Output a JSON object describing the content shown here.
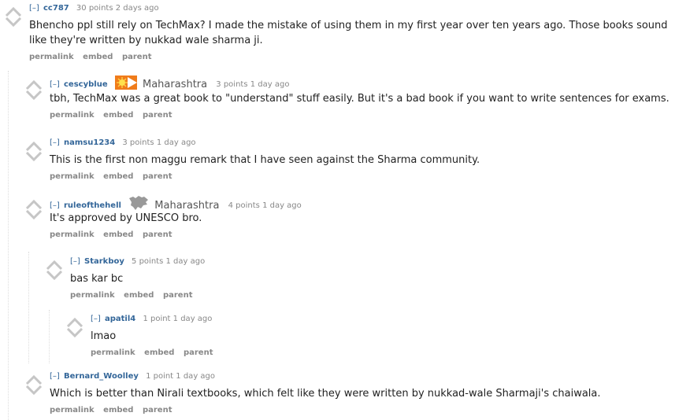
{
  "ui": {
    "expand_label": "[–]"
  },
  "comments": [
    {
      "author": "cc787",
      "score": "30 points",
      "time": "2 days ago",
      "text": "Bhencho ppl still rely on TechMax? I made the mistake of using them in my first year over ten years ago. Those books sound like they're written by nukkad wale sharma ji.",
      "buttons": [
        "permalink",
        "embed",
        "parent"
      ]
    },
    {
      "author": "cescyblue",
      "flair": "Maharashtra",
      "flair_icon": "maharashtra-flag-icon",
      "score": "3 points",
      "time": "1 day ago",
      "text": "tbh, TechMax was a great book to \"understand\" stuff easily. But it's a bad book if you want to write sentences for exams.",
      "buttons": [
        "permalink",
        "embed",
        "parent"
      ]
    },
    {
      "author": "namsu1234",
      "score": "3 points",
      "time": "1 day ago",
      "text": "This is the first non maggu remark that I have seen against the Sharma community.",
      "buttons": [
        "permalink",
        "embed",
        "parent"
      ]
    },
    {
      "author": "ruleofthehell",
      "flair": "Maharashtra",
      "flair_icon": "maharashtra-map-icon",
      "score": "4 points",
      "time": "1 day ago",
      "text": "It's approved by UNESCO bro.",
      "buttons": [
        "permalink",
        "embed",
        "parent"
      ]
    },
    {
      "author": "Starkboy",
      "score": "5 points",
      "time": "1 day ago",
      "text": "bas kar bc",
      "buttons": [
        "permalink",
        "embed",
        "parent"
      ]
    },
    {
      "author": "apatil4",
      "score": "1 point",
      "time": "1 day ago",
      "text": "lmao",
      "buttons": [
        "permalink",
        "embed",
        "parent"
      ]
    },
    {
      "author": "Bernard_Woolley",
      "score": "1 point",
      "time": "1 day ago",
      "text": "Which is better than Nirali textbooks, which felt like they were written by nukkad-wale Sharmaji's chaiwala.",
      "buttons": [
        "permalink",
        "embed",
        "parent"
      ]
    }
  ],
  "colors": {
    "author": "#336699",
    "meta": "#888888",
    "text": "#222222",
    "arrow": "#c6c6c6",
    "flag": "#f07c1b"
  }
}
